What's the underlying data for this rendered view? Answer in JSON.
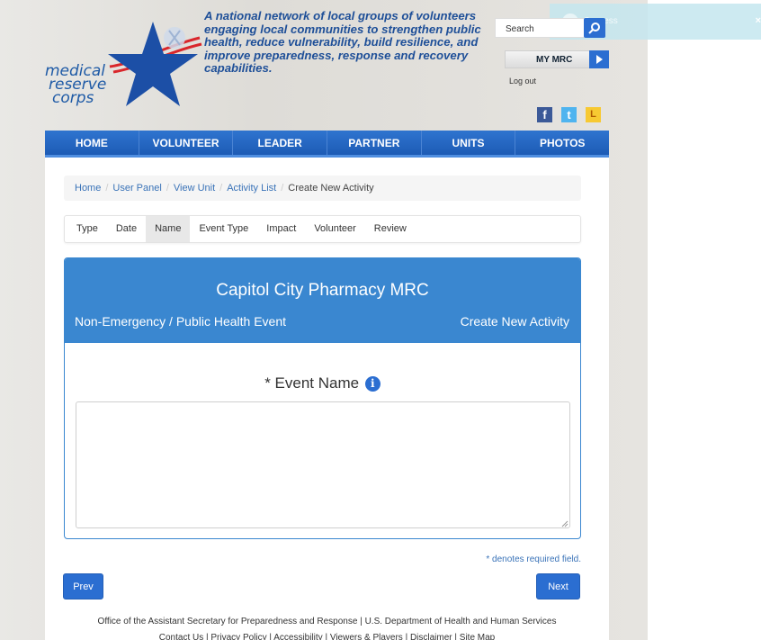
{
  "notification": {
    "message": "Success",
    "close": "×"
  },
  "logo": {
    "line1": "medical",
    "line2": "reserve",
    "line3": "corps"
  },
  "tagline": "A national network of local groups of volunteers engaging local communities to strengthen public health, reduce vulnerability, build resilience, and improve preparedness, response and recovery capabilities.",
  "header": {
    "search_placeholder": "Search",
    "my_mrc": "MY MRC",
    "logout": "Log out",
    "social": {
      "facebook": "f",
      "twitter": "t",
      "linkedin": "L"
    }
  },
  "nav": [
    "HOME",
    "VOLUNTEER",
    "LEADER",
    "PARTNER",
    "UNITS",
    "PHOTOS"
  ],
  "breadcrumb": {
    "home": "Home",
    "user_panel": "User Panel",
    "view_unit": "View Unit",
    "activity_list": "Activity List",
    "current": "Create New Activity",
    "separator": "/"
  },
  "steps": [
    "Type",
    "Date",
    "Name",
    "Event Type",
    "Impact",
    "Volunteer",
    "Review"
  ],
  "active_step": "Name",
  "panel": {
    "title": "Capitol City Pharmacy MRC",
    "subtitle_left": "Non-Emergency / Public Health Event",
    "subtitle_right": "Create New Activity",
    "field_label": "* Event Name",
    "field_value": ""
  },
  "required_note": "* denotes required field.",
  "buttons": {
    "prev": "Prev",
    "next": "Next"
  },
  "footer": {
    "line1": "Office of the Assistant Secretary for Preparedness and Response | U.S. Department of Health and Human Services",
    "line2": "Contact Us  |  Privacy Policy  |  Accessibility  |  Viewers & Players  |  Disclaimer  |  Site Map"
  },
  "colors": {
    "brand_blue": "#2b6ed1",
    "panel_blue": "#3a87d0",
    "star_red": "#d9262b"
  }
}
